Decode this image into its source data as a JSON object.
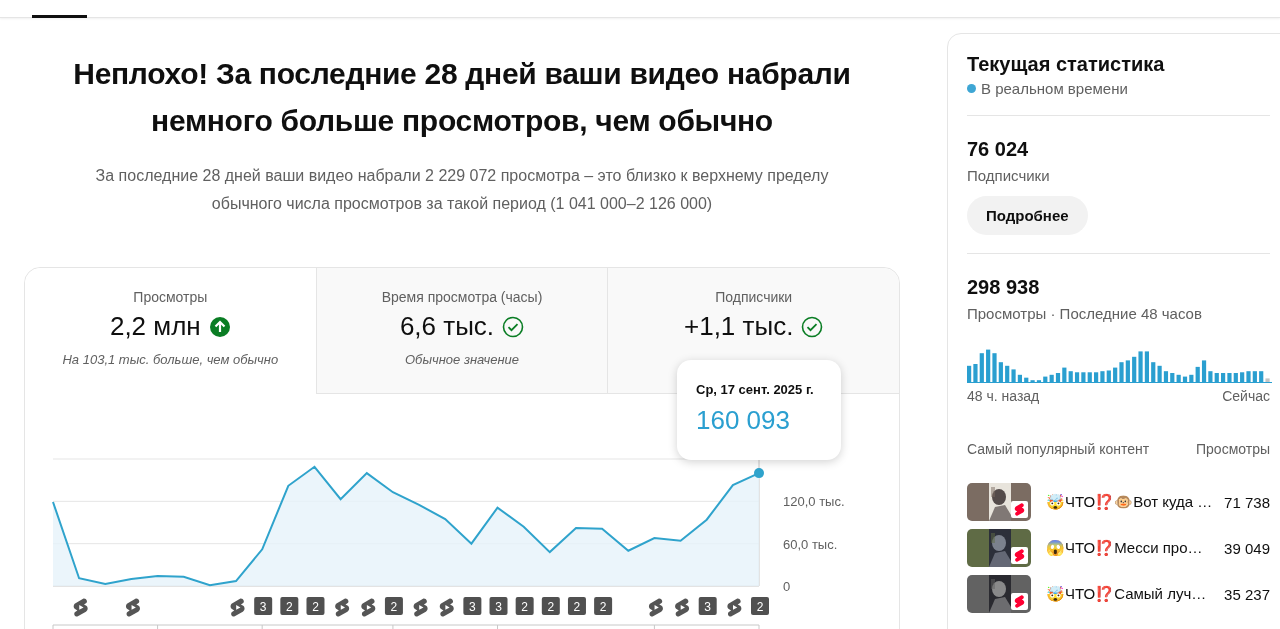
{
  "headline": "Неплохо! За последние 28 дней ваши видео набрали немного больше просмотров, чем обычно",
  "summary": "За последние 28 дней ваши видео набрали 2 229 072 просмотра – это близко к верхнему пределу обычного числа просмотров за такой период (1 041 000–2 126 000)",
  "metrics": [
    {
      "label": "Просмотры",
      "value": "2,2 млн",
      "kind": "above",
      "note": "На 103,1 тыс. больше, чем обычно",
      "selected": true
    },
    {
      "label": "Время просмотра (часы)",
      "value": "6,6 тыс.",
      "kind": "normal",
      "note": "Обычное значение",
      "selected": false
    },
    {
      "label": "Подписчики",
      "value": "+1,1 тыс.",
      "kind": "normal",
      "selected": false
    }
  ],
  "chart": {
    "chart_data": {
      "type": "area",
      "ylim": [
        0,
        180
      ],
      "yticks": [
        {
          "value": 0,
          "label": "0"
        },
        {
          "value": 60,
          "label": "60,0 тыс."
        },
        {
          "value": 120,
          "label": "120,0 тыс."
        }
      ],
      "series": [
        {
          "color": "#2fa3cc",
          "values": [
            119,
            11,
            3,
            10,
            14,
            13,
            1,
            7,
            52,
            142,
            169,
            123,
            160,
            133,
            115,
            95,
            60,
            111,
            84,
            48,
            82,
            81,
            50,
            68,
            64,
            94,
            143,
            160
          ]
        }
      ]
    },
    "tooltip": {
      "date": "Ср, 17 сент. 2025 г.",
      "value": "160 093"
    },
    "day_markers": [
      {
        "kind": "empty"
      },
      {
        "kind": "shorts"
      },
      {
        "kind": "empty"
      },
      {
        "kind": "shorts"
      },
      {
        "kind": "empty"
      },
      {
        "kind": "empty"
      },
      {
        "kind": "empty"
      },
      {
        "kind": "shorts"
      },
      {
        "kind": "count",
        "label": "3"
      },
      {
        "kind": "count",
        "label": "2"
      },
      {
        "kind": "count",
        "label": "2"
      },
      {
        "kind": "shorts"
      },
      {
        "kind": "shorts"
      },
      {
        "kind": "count",
        "label": "2"
      },
      {
        "kind": "shorts"
      },
      {
        "kind": "shorts"
      },
      {
        "kind": "count",
        "label": "3"
      },
      {
        "kind": "count",
        "label": "3"
      },
      {
        "kind": "count",
        "label": "2"
      },
      {
        "kind": "count",
        "label": "2"
      },
      {
        "kind": "count",
        "label": "2"
      },
      {
        "kind": "count",
        "label": "2"
      },
      {
        "kind": "empty"
      },
      {
        "kind": "shorts"
      },
      {
        "kind": "shorts"
      },
      {
        "kind": "count",
        "label": "3"
      },
      {
        "kind": "shorts"
      },
      {
        "kind": "count",
        "label": "2"
      }
    ]
  },
  "realtime": {
    "title": "Текущая статистика",
    "live_label": "В реальном времени",
    "subscribers": {
      "value": "76 024",
      "label": "Подписчики",
      "button": "Подробнее"
    },
    "views": {
      "value": "298 938",
      "label": "Просмотры · Последние 48 часов",
      "start_label": "48 ч. назад",
      "end_label": "Сейчас"
    },
    "top_content": {
      "header": "Самый популярный контент",
      "views_header": "Просмотры",
      "rows": [
        {
          "title": "🤯ЧТО⁉️🐵Вот куда …",
          "views": "71 738"
        },
        {
          "title": "😱ЧТО⁉️Месси про…",
          "views": "39 049"
        },
        {
          "title": "🤯ЧТО⁉️Самый луч…",
          "views": "35 237"
        }
      ]
    }
  }
}
